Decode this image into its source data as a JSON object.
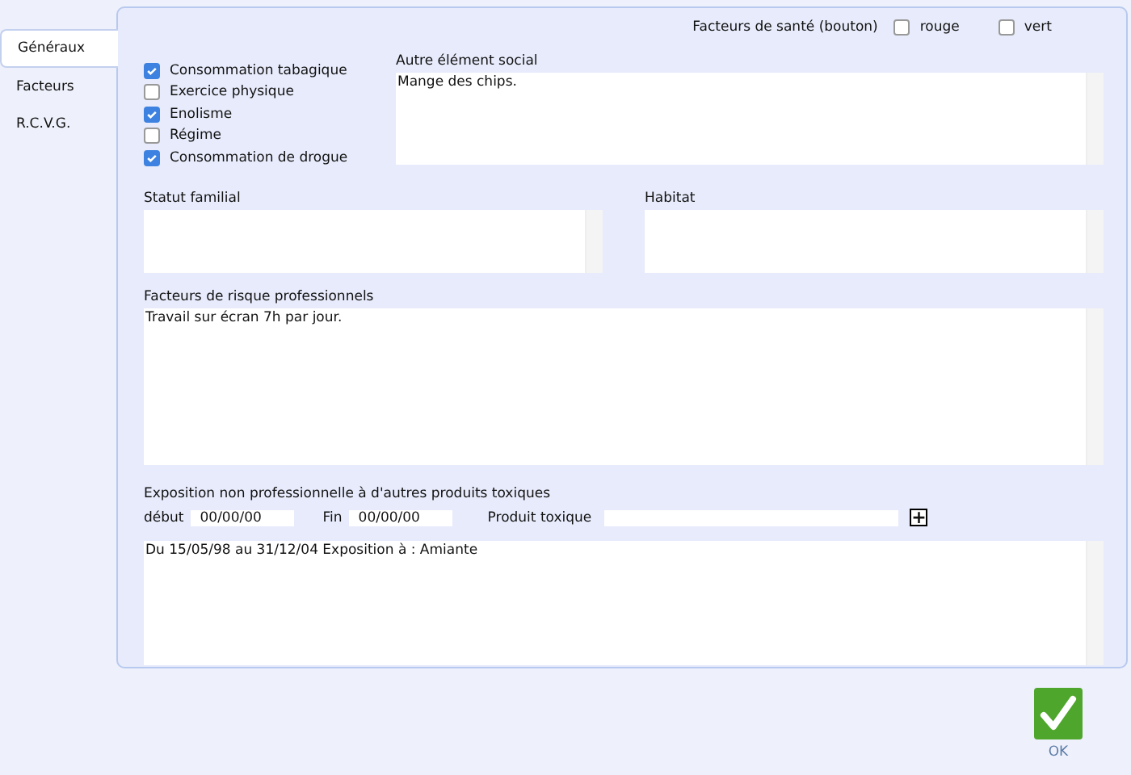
{
  "tabs": [
    {
      "label": "Généraux",
      "selected": true
    },
    {
      "label": "Facteurs",
      "selected": false
    },
    {
      "label": "R.C.V.G.",
      "selected": false
    }
  ],
  "health_factors": {
    "label": "Facteurs de santé (bouton)",
    "options": [
      {
        "label": "rouge",
        "checked": false
      },
      {
        "label": "vert",
        "checked": false
      }
    ]
  },
  "habits": [
    {
      "label": "Consommation tabagique",
      "checked": true
    },
    {
      "label": "Exercice physique",
      "checked": false
    },
    {
      "label": "Enolisme",
      "checked": true
    },
    {
      "label": "Régime",
      "checked": false
    },
    {
      "label": "Consommation de drogue",
      "checked": true
    }
  ],
  "other_social": {
    "label": "Autre élément social",
    "value": "Mange des chips."
  },
  "family_status": {
    "label": "Statut familial"
  },
  "housing": {
    "label": "Habitat"
  },
  "occupational_risks": {
    "label": "Facteurs de risque professionnels",
    "value": "Travail sur écran 7h par jour."
  },
  "exposure": {
    "label": "Exposition non professionnelle à d'autres produits toxiques",
    "start_label": "début",
    "start_value": "00/00/00",
    "end_label": "Fin",
    "end_value": "00/00/00",
    "product_label": "Produit toxique",
    "add_button": "+",
    "history": "Du 15/05/98 au 31/12/04 Exposition à : Amiante"
  },
  "ok_button": "OK"
}
